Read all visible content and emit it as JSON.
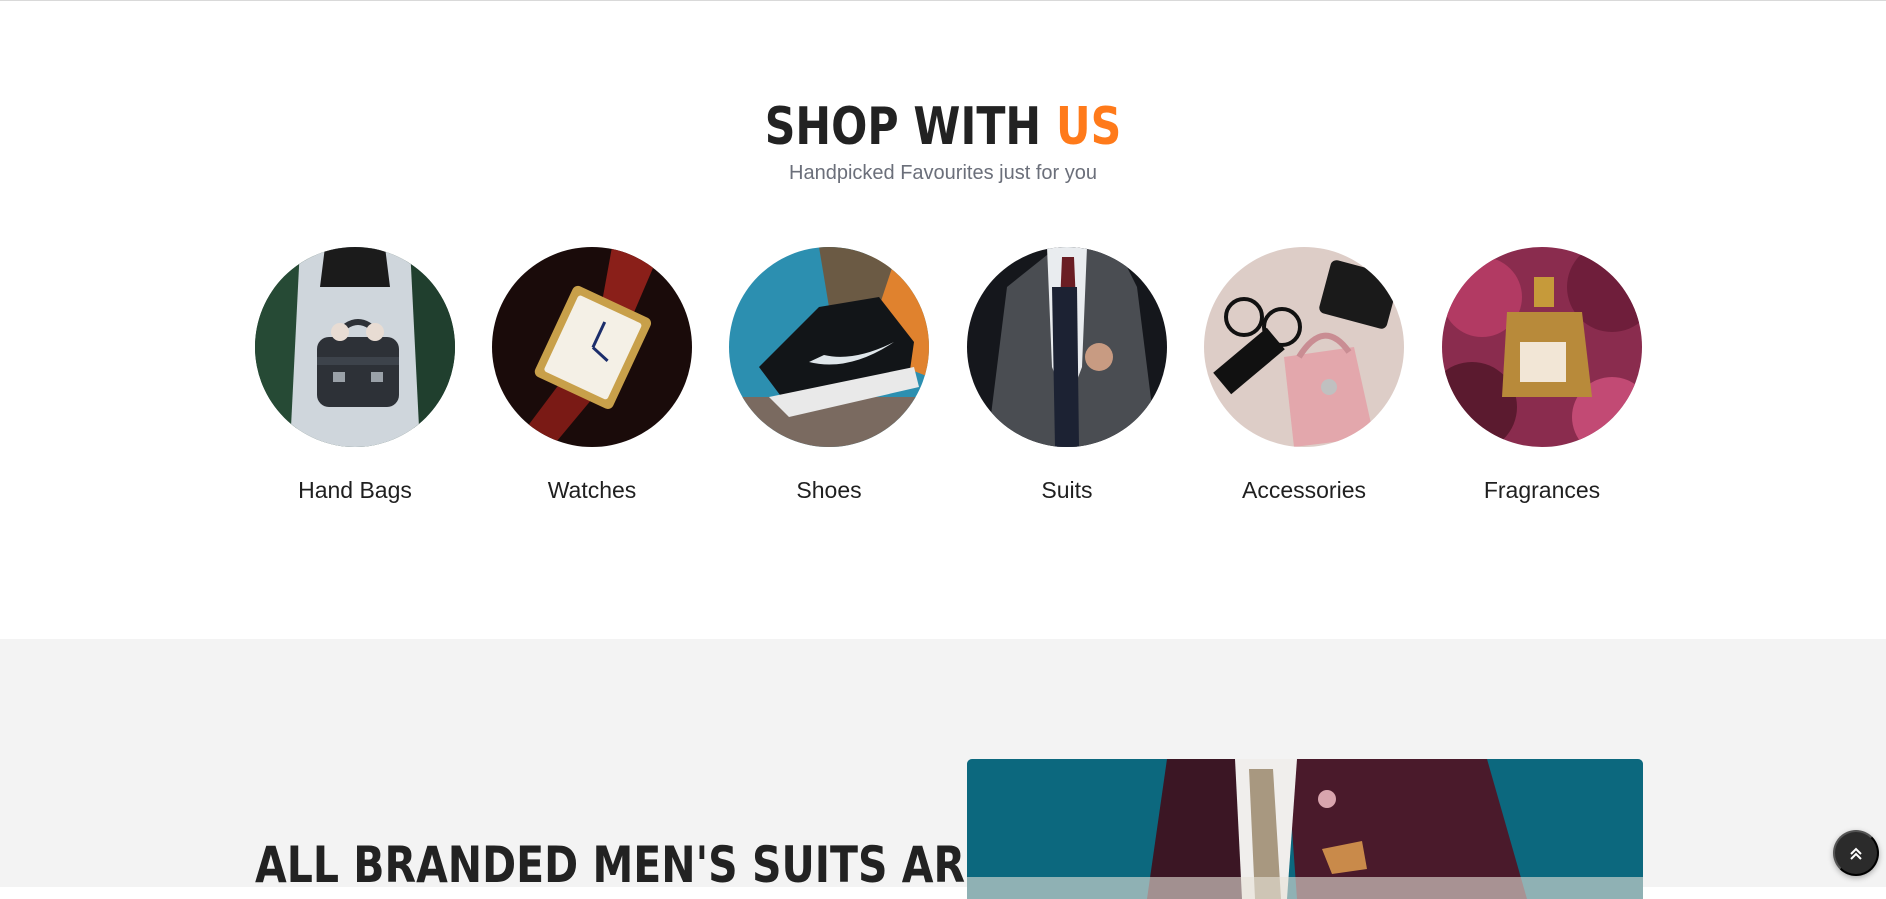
{
  "shop": {
    "title_main": "SHOP WITH",
    "title_accent": "US",
    "subtitle": "Handpicked Favourites just for you",
    "accent_color": "#ff7a1a",
    "categories": [
      {
        "label": "Hand Bags",
        "icon": "handbag-photo"
      },
      {
        "label": "Watches",
        "icon": "watch-photo"
      },
      {
        "label": "Shoes",
        "icon": "shoe-photo"
      },
      {
        "label": "Suits",
        "icon": "suit-photo"
      },
      {
        "label": "Accessories",
        "icon": "accessories-photo"
      },
      {
        "label": "Fragrances",
        "icon": "perfume-photo"
      }
    ]
  },
  "promo": {
    "heading": "ALL BRANDED MEN'S SUITS ARE",
    "image": "man-in-suit-photo"
  },
  "scroll_top": {
    "icon": "double-chevron-up-icon"
  }
}
